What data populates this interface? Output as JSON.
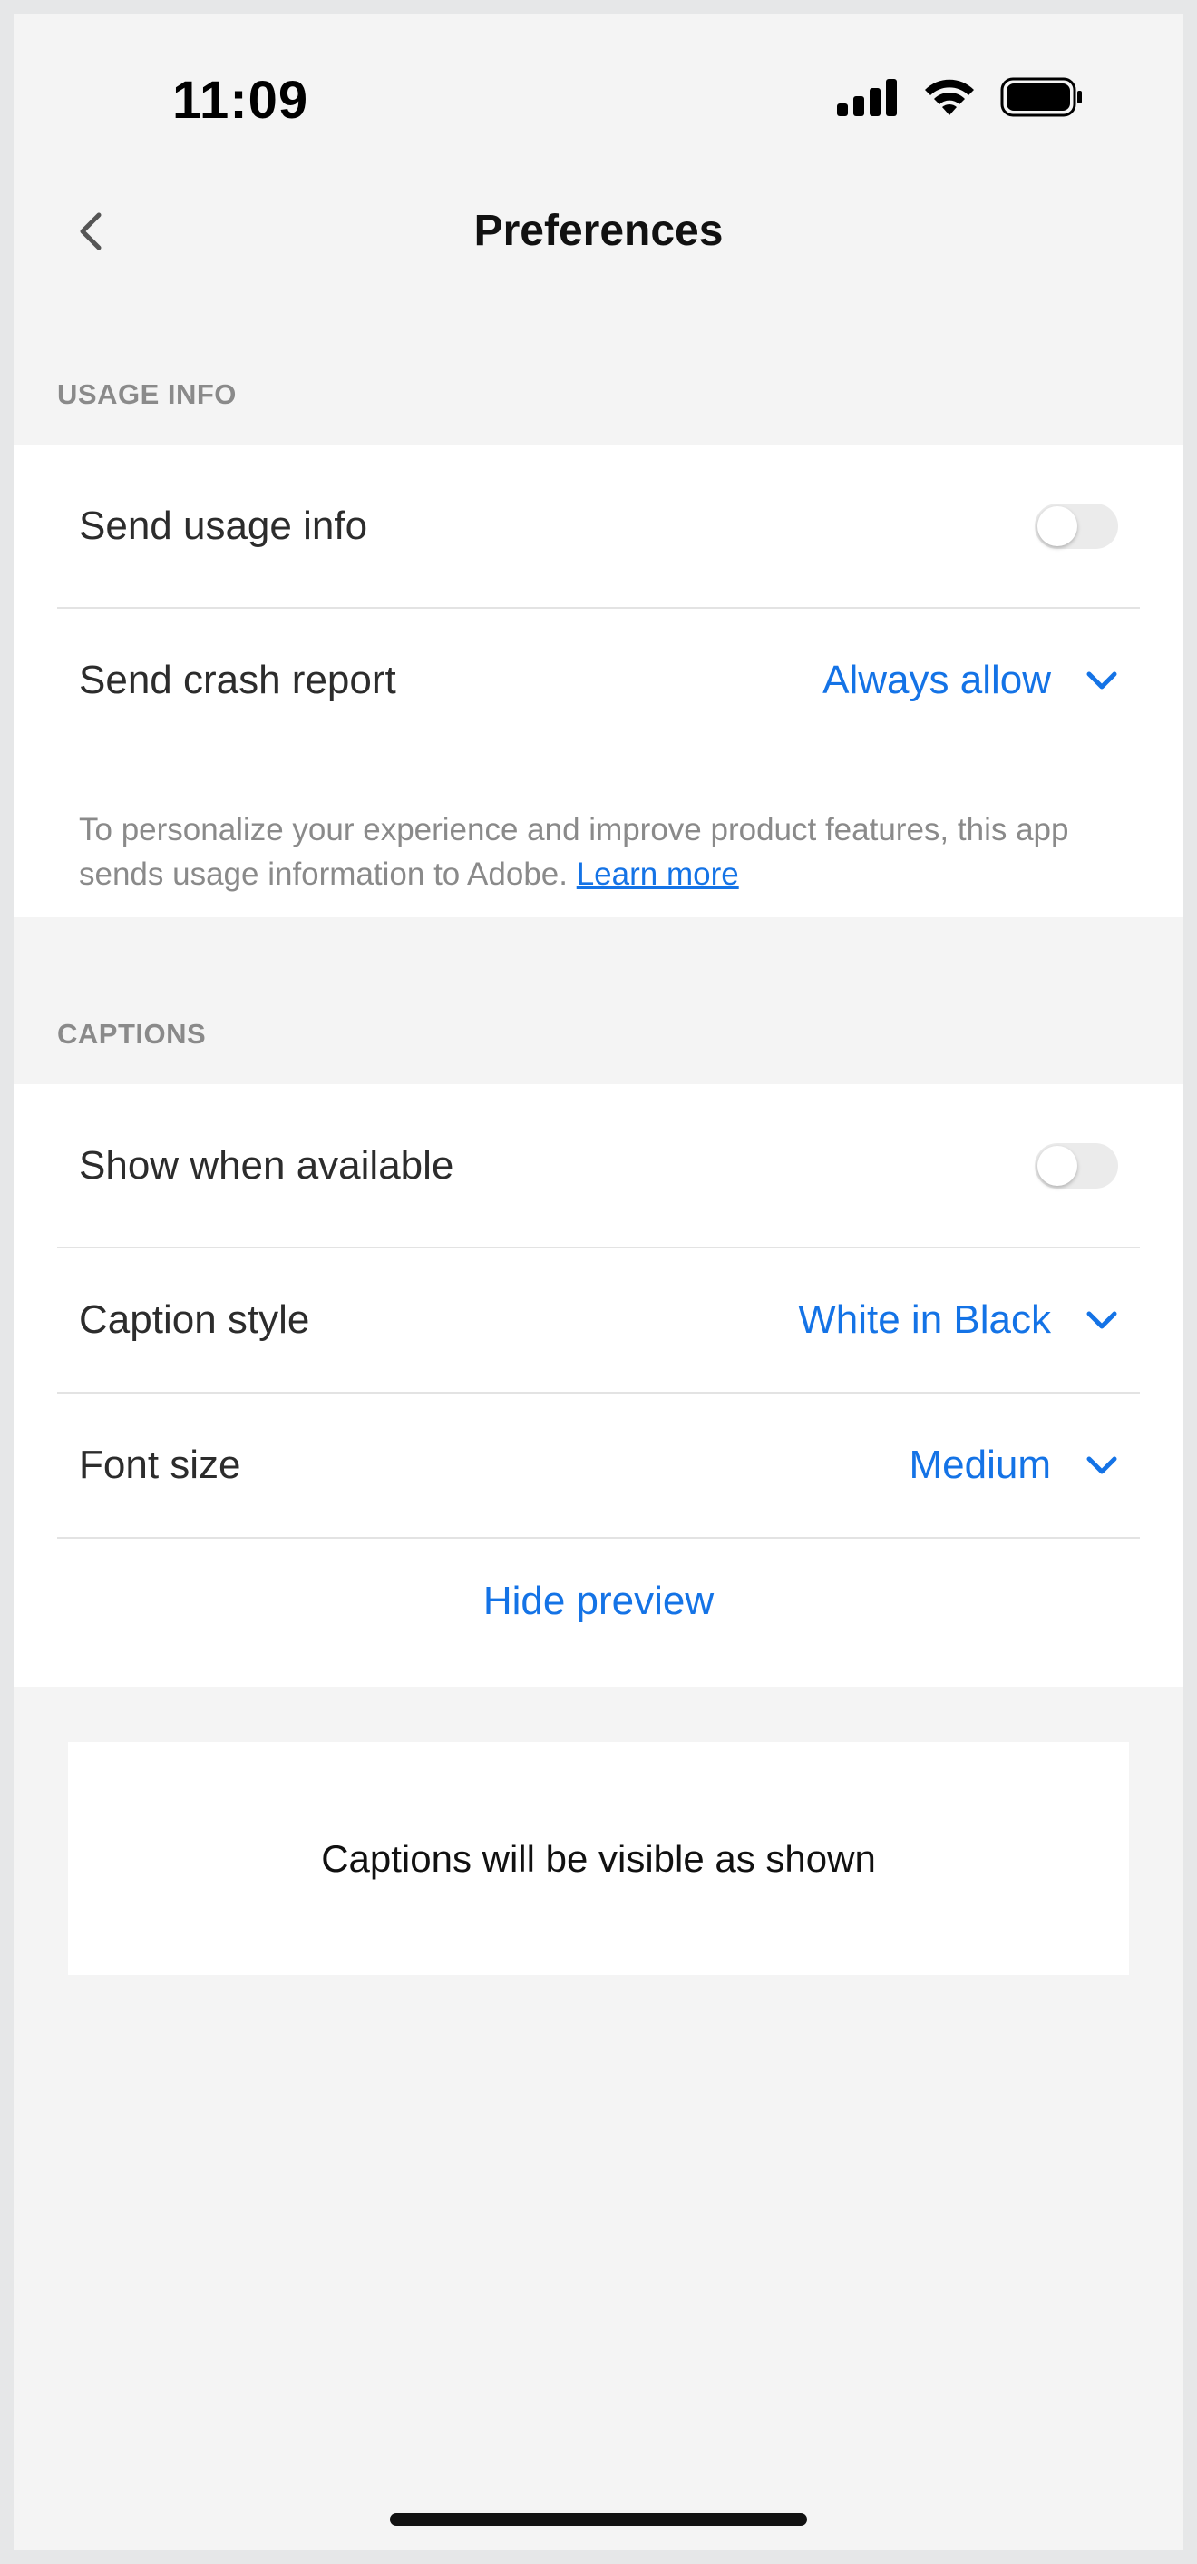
{
  "status_bar": {
    "time": "11:09",
    "icons": [
      "signal-icon",
      "wifi-icon",
      "battery-icon"
    ]
  },
  "nav": {
    "back_icon": "chevron-left-icon",
    "title": "Preferences"
  },
  "usage_info": {
    "header": "USAGE INFO",
    "send_usage": {
      "label": "Send usage info",
      "toggle_on": false
    },
    "send_crash": {
      "label": "Send crash report",
      "value": "Always allow",
      "icon": "chevron-down-icon"
    },
    "info_text": "To personalize your experience and improve product features, this app sends usage information to Adobe.",
    "learn_more": "Learn more"
  },
  "captions": {
    "header": "CAPTIONS",
    "show_when_available": {
      "label": "Show when available",
      "toggle_on": false
    },
    "caption_style": {
      "label": "Caption style",
      "value": "White in Black",
      "icon": "chevron-down-icon"
    },
    "font_size": {
      "label": "Font size",
      "value": "Medium",
      "icon": "chevron-down-icon"
    },
    "hide_preview": "Hide preview",
    "preview_text": "Captions will be visible as shown"
  },
  "colors": {
    "accent": "#1473e6",
    "background": "#f4f4f4",
    "card": "#ffffff",
    "secondary_text": "#8a8a8a"
  }
}
